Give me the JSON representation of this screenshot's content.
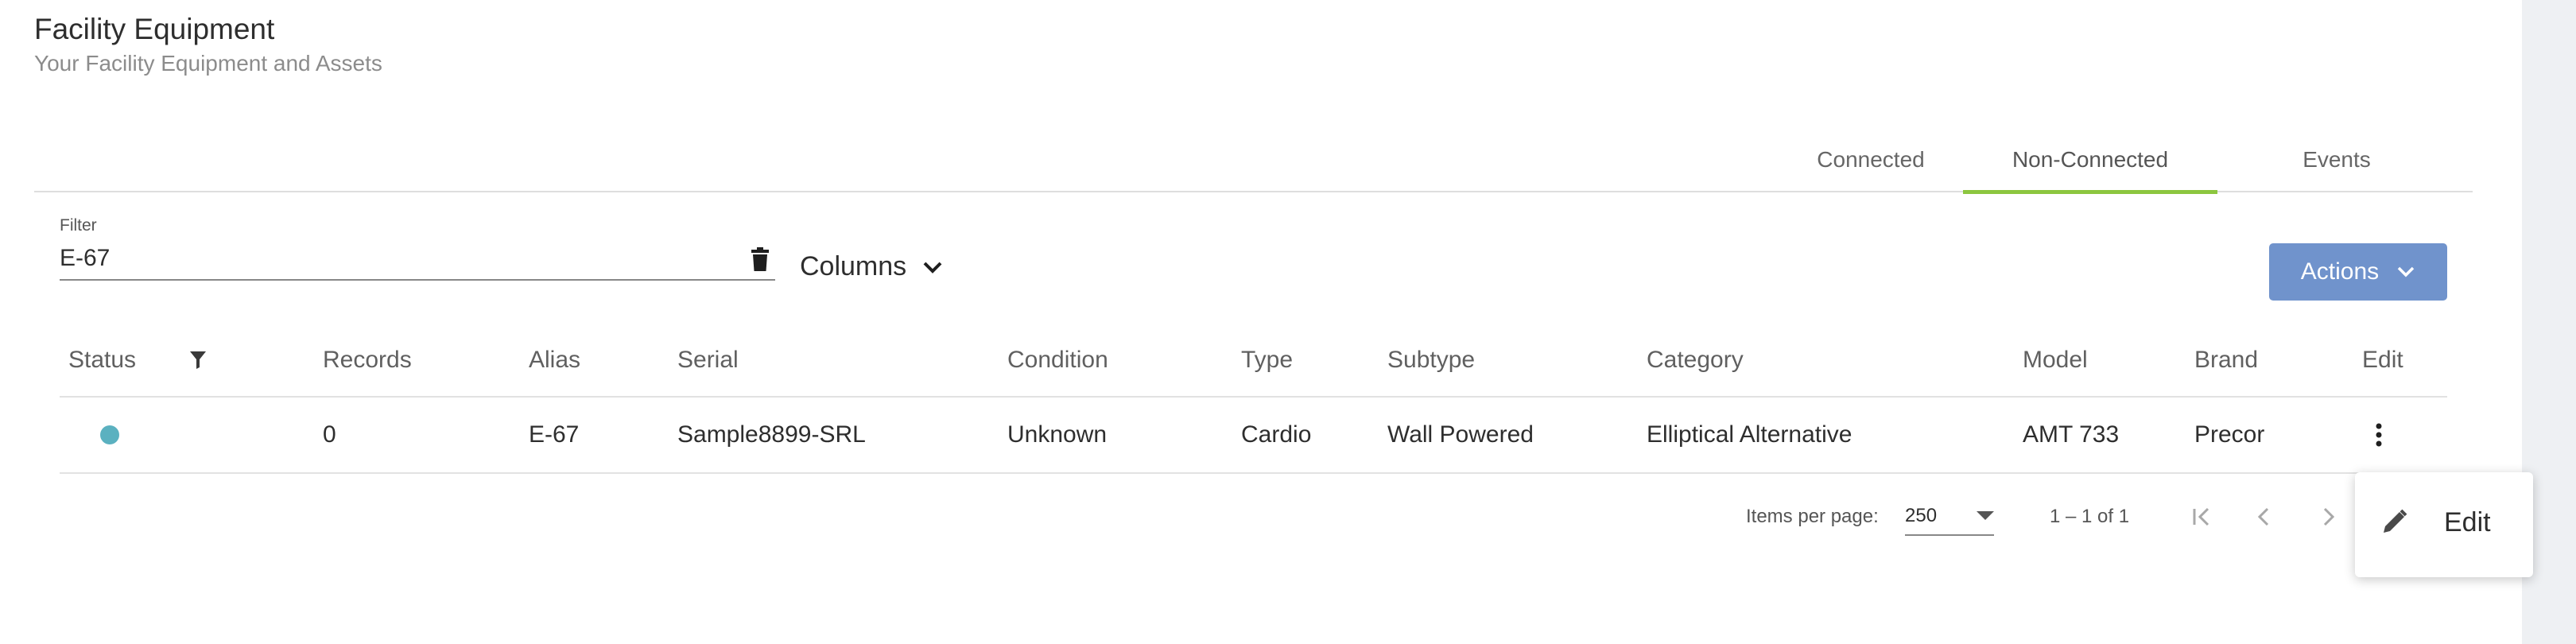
{
  "header": {
    "title": "Facility Equipment",
    "subtitle": "Your Facility Equipment and Assets"
  },
  "tabs": [
    {
      "label": "Connected",
      "active": false
    },
    {
      "label": "Non-Connected",
      "active": true
    },
    {
      "label": "Events",
      "active": false
    }
  ],
  "filter": {
    "label": "Filter",
    "value": "E-67"
  },
  "columns_label": "Columns",
  "actions_label": "Actions",
  "table": {
    "headers": {
      "status": "Status",
      "records": "Records",
      "alias": "Alias",
      "serial": "Serial",
      "condition": "Condition",
      "type": "Type",
      "subtype": "Subtype",
      "category": "Category",
      "model": "Model",
      "brand": "Brand",
      "edit": "Edit"
    },
    "rows": [
      {
        "status_color": "#5bb1c0",
        "records": "0",
        "alias": "E-67",
        "serial": "Sample8899-SRL",
        "condition": "Unknown",
        "type": "Cardio",
        "subtype": "Wall Powered",
        "category": "Elliptical Alternative",
        "model": "AMT 733",
        "brand": "Precor"
      }
    ]
  },
  "paginator": {
    "items_per_page_label": "Items per page:",
    "page_size": "250",
    "range_label": "1 – 1 of 1"
  },
  "context_menu": {
    "edit_label": "Edit"
  },
  "colors": {
    "accent_tab": "#8cc63f",
    "actions_button": "#7093cc",
    "status_dot": "#5bb1c0"
  }
}
